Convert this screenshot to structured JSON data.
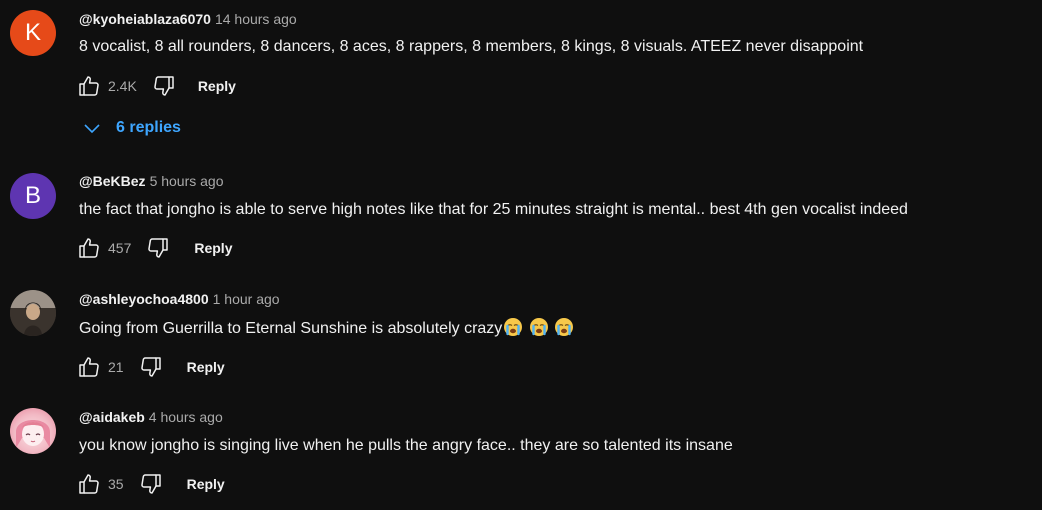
{
  "comments": [
    {
      "avatar_letter": "K",
      "author": "@kyoheiablaza6070",
      "time": "14 hours ago",
      "text": "8 vocalist, 8 all rounders, 8 dancers, 8 aces, 8 rappers, 8 members, 8 kings, 8 visuals. ATEEZ never disappoint",
      "likes": "2.4K",
      "reply_label": "Reply",
      "replies_label": "6 replies"
    },
    {
      "avatar_letter": "B",
      "author": "@BeKBez",
      "time": "5 hours ago",
      "text": "the fact that jongho is able to serve high notes like that for 25 minutes straight is mental.. best 4th gen vocalist indeed",
      "likes": "457",
      "reply_label": "Reply"
    },
    {
      "author": "@ashleyochoa4800",
      "time": "1 hour ago",
      "text": "Going from Guerrilla to Eternal Sunshine is absolutely crazy",
      "emoji": [
        "loudly-crying-face",
        "loudly-crying-face",
        "loudly-crying-face"
      ],
      "likes": "21",
      "reply_label": "Reply"
    },
    {
      "author": "@aidakeb",
      "time": "4 hours ago",
      "text": "you know jongho is singing live when he pulls the angry face.. they are so talented its insane",
      "likes": "35",
      "reply_label": "Reply"
    }
  ],
  "colors": {
    "background": "#0f0f0f",
    "primary_text": "#f1f1f1",
    "secondary_text": "#aaaaaa",
    "link": "#3ea6ff",
    "avatar_k": "#e64a19",
    "avatar_b": "#5e35b1"
  },
  "icons": [
    "like-icon",
    "dislike-icon",
    "chevron-down-icon",
    "loudly-crying-face-emoji"
  ]
}
